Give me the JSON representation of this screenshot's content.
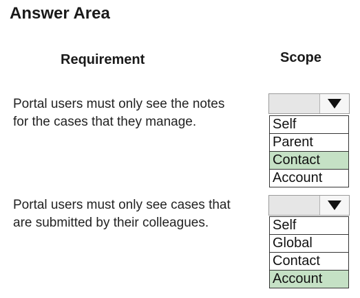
{
  "page": {
    "title": "Answer Area"
  },
  "headers": {
    "requirement": "Requirement",
    "scope": "Scope"
  },
  "questions": [
    {
      "lines": [
        "Portal users must only see the notes",
        "for the cases that they manage."
      ],
      "options": [
        "Self",
        "Parent",
        "Contact",
        "Account"
      ],
      "selected": "Contact"
    },
    {
      "lines": [
        "Portal users must only see cases that",
        "are submitted by their colleagues."
      ],
      "options": [
        "Self",
        "Global",
        "Contact",
        "Account"
      ],
      "selected": "Account"
    }
  ],
  "icons": {
    "dropdown_arrow": "triangle-down-icon"
  },
  "colors": {
    "selected_highlight": "#c5e1c5"
  }
}
